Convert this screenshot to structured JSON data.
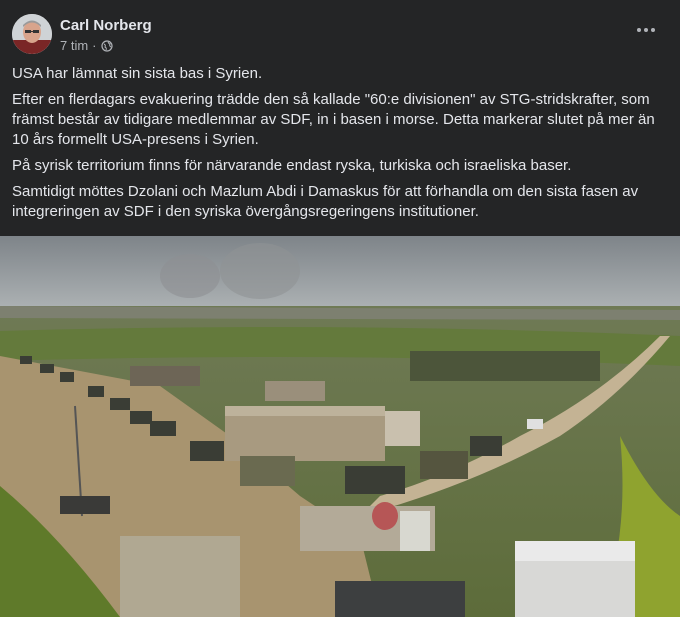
{
  "post": {
    "author": "Carl Norberg",
    "time": "7 tim",
    "separator": "·",
    "paragraphs": [
      "USA har lämnat sin sista bas i Syrien.",
      "Efter en flerdagars evakuering trädde den så kallade \"60:e divisionen\" av STG-stridskrafter, som främst består av tidigare medlemmar av SDF, in i basen i morse. Detta markerar slutet på mer än 10 års formellt USA-presens i Syrien.",
      "På syrisk territorium finns för närvarande endast ryska, turkiska och israeliska baser.",
      "Samtidigt möttes Dzolani och Mazlum Abdi i Damaskus för att förhandla om den sista fasen av integreringen av SDF i den syriska övergångsregeringens institutioner."
    ]
  },
  "icons": {
    "privacy": "globe-icon",
    "more": "more-options-icon"
  },
  "colors": {
    "background": "#242526",
    "text_primary": "#e4e6eb",
    "text_secondary": "#b0b3b8"
  }
}
